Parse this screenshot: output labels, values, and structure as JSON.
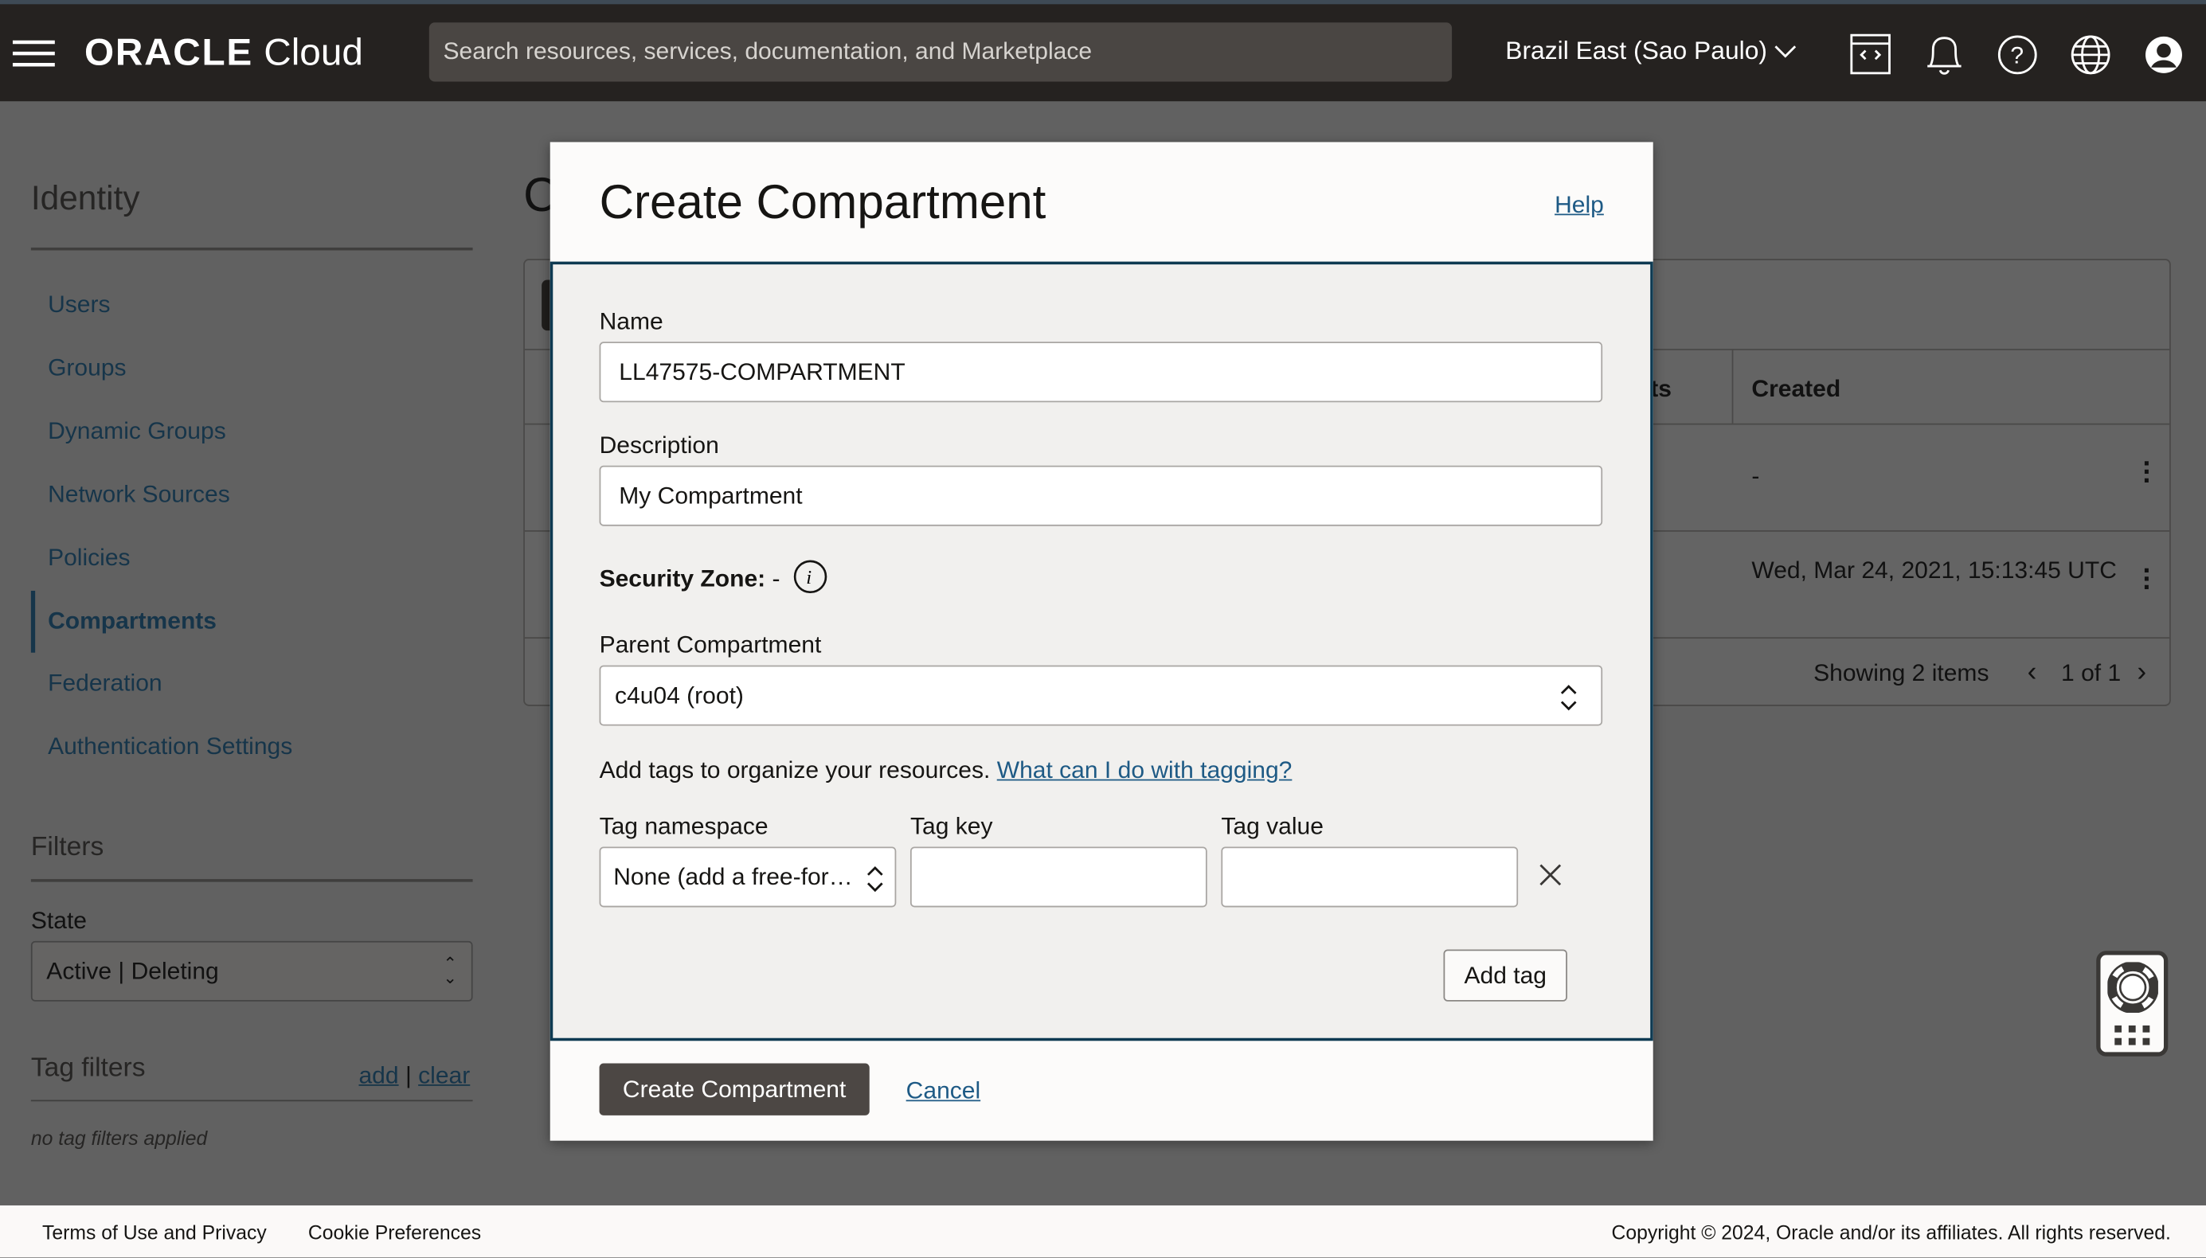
{
  "header": {
    "logo": "ORACLE Cloud",
    "search_placeholder": "Search resources, services, documentation, and Marketplace",
    "region": "Brazil East (Sao Paulo)"
  },
  "sidebar": {
    "title": "Identity",
    "items": [
      {
        "label": "Users"
      },
      {
        "label": "Groups"
      },
      {
        "label": "Dynamic Groups"
      },
      {
        "label": "Network Sources"
      },
      {
        "label": "Policies"
      },
      {
        "label": "Compartments",
        "active": true
      },
      {
        "label": "Federation"
      },
      {
        "label": "Authentication Settings"
      }
    ],
    "filters_title": "Filters",
    "state_label": "State",
    "state_value": "Active | Deleting",
    "tag_filters": "Tag filters",
    "add": "add",
    "sep": "|",
    "clear": "clear",
    "no_tags": "no tag filters applied"
  },
  "main": {
    "title_partial": "C",
    "table": {
      "col_partial": "ts",
      "col_created": "Created",
      "rows": [
        {
          "created": "-"
        },
        {
          "created": "Wed, Mar 24, 2021, 15:13:45 UTC"
        }
      ],
      "showing": "Showing 2 items",
      "page": "1 of 1"
    }
  },
  "modal": {
    "title": "Create Compartment",
    "help": "Help",
    "name_label": "Name",
    "name_value": "LL47575-COMPARTMENT",
    "desc_label": "Description",
    "desc_value": "My Compartment",
    "security_zone_label": "Security Zone:",
    "security_zone_value": "-",
    "parent_label": "Parent Compartment",
    "parent_value": "c4u04 (root)",
    "tags_text": "Add tags to organize your resources.",
    "tags_link": "What can I do with tagging?",
    "tag_ns_label": "Tag namespace",
    "tag_ns_value": "None (add a free-for…",
    "tag_key_label": "Tag key",
    "tag_value_label": "Tag value",
    "add_tag": "Add tag",
    "create": "Create Compartment",
    "cancel": "Cancel"
  },
  "footer": {
    "terms": "Terms of Use and Privacy",
    "cookies": "Cookie Preferences",
    "copyright": "Copyright © 2024, Oracle and/or its affiliates. All rights reserved."
  }
}
